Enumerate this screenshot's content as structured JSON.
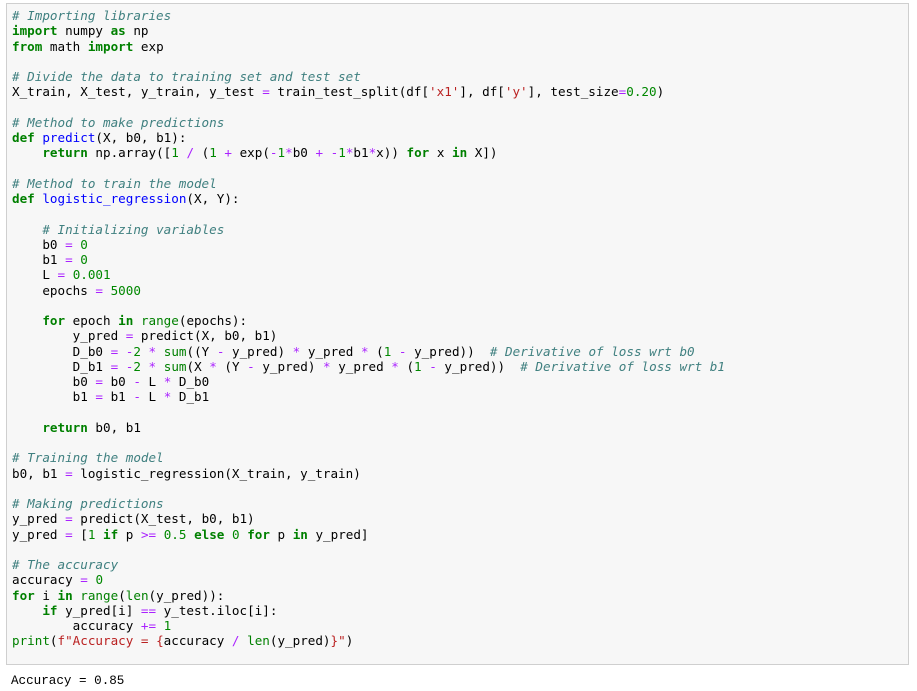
{
  "cell": {
    "lines": [
      [
        [
          "cm",
          "# Importing libraries"
        ]
      ],
      [
        [
          "kw",
          "import"
        ],
        [
          "tx",
          " numpy "
        ],
        [
          "kw",
          "as"
        ],
        [
          "tx",
          " np"
        ]
      ],
      [
        [
          "kw",
          "from"
        ],
        [
          "tx",
          " math "
        ],
        [
          "kw",
          "import"
        ],
        [
          "tx",
          " exp"
        ]
      ],
      [],
      [
        [
          "cm",
          "# Divide the data to training set and test set"
        ]
      ],
      [
        [
          "tx",
          "X_train, X_test, y_train, y_test "
        ],
        [
          "op",
          "="
        ],
        [
          "tx",
          " train_test_split(df["
        ],
        [
          "st",
          "'x1'"
        ],
        [
          "tx",
          "], df["
        ],
        [
          "st",
          "'y'"
        ],
        [
          "tx",
          "], test_size"
        ],
        [
          "op",
          "="
        ],
        [
          "nm",
          "0.20"
        ],
        [
          "tx",
          ")"
        ]
      ],
      [],
      [
        [
          "cm",
          "# Method to make predictions"
        ]
      ],
      [
        [
          "kw",
          "def"
        ],
        [
          "tx",
          " "
        ],
        [
          "fn",
          "predict"
        ],
        [
          "tx",
          "(X, b0, b1):"
        ]
      ],
      [
        [
          "tx",
          "    "
        ],
        [
          "kw",
          "return"
        ],
        [
          "tx",
          " np.array(["
        ],
        [
          "nm",
          "1"
        ],
        [
          "tx",
          " "
        ],
        [
          "op",
          "/"
        ],
        [
          "tx",
          " ("
        ],
        [
          "nm",
          "1"
        ],
        [
          "tx",
          " "
        ],
        [
          "op",
          "+"
        ],
        [
          "tx",
          " exp("
        ],
        [
          "op",
          "-"
        ],
        [
          "nm",
          "1"
        ],
        [
          "op",
          "*"
        ],
        [
          "tx",
          "b0 "
        ],
        [
          "op",
          "+"
        ],
        [
          "tx",
          " "
        ],
        [
          "op",
          "-"
        ],
        [
          "nm",
          "1"
        ],
        [
          "op",
          "*"
        ],
        [
          "tx",
          "b1"
        ],
        [
          "op",
          "*"
        ],
        [
          "tx",
          "x)) "
        ],
        [
          "kw",
          "for"
        ],
        [
          "tx",
          " x "
        ],
        [
          "kw",
          "in"
        ],
        [
          "tx",
          " X])"
        ]
      ],
      [],
      [
        [
          "cm",
          "# Method to train the model"
        ]
      ],
      [
        [
          "kw",
          "def"
        ],
        [
          "tx",
          " "
        ],
        [
          "fn",
          "logistic_regression"
        ],
        [
          "tx",
          "(X, Y):"
        ]
      ],
      [],
      [
        [
          "tx",
          "    "
        ],
        [
          "cm",
          "# Initializing variables"
        ]
      ],
      [
        [
          "tx",
          "    b0 "
        ],
        [
          "op",
          "="
        ],
        [
          "tx",
          " "
        ],
        [
          "nm",
          "0"
        ]
      ],
      [
        [
          "tx",
          "    b1 "
        ],
        [
          "op",
          "="
        ],
        [
          "tx",
          " "
        ],
        [
          "nm",
          "0"
        ]
      ],
      [
        [
          "tx",
          "    L "
        ],
        [
          "op",
          "="
        ],
        [
          "tx",
          " "
        ],
        [
          "nm",
          "0.001"
        ]
      ],
      [
        [
          "tx",
          "    epochs "
        ],
        [
          "op",
          "="
        ],
        [
          "tx",
          " "
        ],
        [
          "nm",
          "5000"
        ]
      ],
      [],
      [
        [
          "tx",
          "    "
        ],
        [
          "kw",
          "for"
        ],
        [
          "tx",
          " epoch "
        ],
        [
          "kw",
          "in"
        ],
        [
          "tx",
          " "
        ],
        [
          "bi",
          "range"
        ],
        [
          "tx",
          "(epochs):"
        ]
      ],
      [
        [
          "tx",
          "        y_pred "
        ],
        [
          "op",
          "="
        ],
        [
          "tx",
          " predict(X, b0, b1)"
        ]
      ],
      [
        [
          "tx",
          "        D_b0 "
        ],
        [
          "op",
          "="
        ],
        [
          "tx",
          " "
        ],
        [
          "op",
          "-"
        ],
        [
          "nm",
          "2"
        ],
        [
          "tx",
          " "
        ],
        [
          "op",
          "*"
        ],
        [
          "tx",
          " "
        ],
        [
          "bi",
          "sum"
        ],
        [
          "tx",
          "((Y "
        ],
        [
          "op",
          "-"
        ],
        [
          "tx",
          " y_pred) "
        ],
        [
          "op",
          "*"
        ],
        [
          "tx",
          " y_pred "
        ],
        [
          "op",
          "*"
        ],
        [
          "tx",
          " ("
        ],
        [
          "nm",
          "1"
        ],
        [
          "tx",
          " "
        ],
        [
          "op",
          "-"
        ],
        [
          "tx",
          " y_pred))  "
        ],
        [
          "cm",
          "# Derivative of loss wrt b0"
        ]
      ],
      [
        [
          "tx",
          "        D_b1 "
        ],
        [
          "op",
          "="
        ],
        [
          "tx",
          " "
        ],
        [
          "op",
          "-"
        ],
        [
          "nm",
          "2"
        ],
        [
          "tx",
          " "
        ],
        [
          "op",
          "*"
        ],
        [
          "tx",
          " "
        ],
        [
          "bi",
          "sum"
        ],
        [
          "tx",
          "(X "
        ],
        [
          "op",
          "*"
        ],
        [
          "tx",
          " (Y "
        ],
        [
          "op",
          "-"
        ],
        [
          "tx",
          " y_pred) "
        ],
        [
          "op",
          "*"
        ],
        [
          "tx",
          " y_pred "
        ],
        [
          "op",
          "*"
        ],
        [
          "tx",
          " ("
        ],
        [
          "nm",
          "1"
        ],
        [
          "tx",
          " "
        ],
        [
          "op",
          "-"
        ],
        [
          "tx",
          " y_pred))  "
        ],
        [
          "cm",
          "# Derivative of loss wrt b1"
        ]
      ],
      [
        [
          "tx",
          "        b0 "
        ],
        [
          "op",
          "="
        ],
        [
          "tx",
          " b0 "
        ],
        [
          "op",
          "-"
        ],
        [
          "tx",
          " L "
        ],
        [
          "op",
          "*"
        ],
        [
          "tx",
          " D_b0"
        ]
      ],
      [
        [
          "tx",
          "        b1 "
        ],
        [
          "op",
          "="
        ],
        [
          "tx",
          " b1 "
        ],
        [
          "op",
          "-"
        ],
        [
          "tx",
          " L "
        ],
        [
          "op",
          "*"
        ],
        [
          "tx",
          " D_b1"
        ]
      ],
      [],
      [
        [
          "tx",
          "    "
        ],
        [
          "kw",
          "return"
        ],
        [
          "tx",
          " b0, b1"
        ]
      ],
      [],
      [
        [
          "cm",
          "# Training the model"
        ]
      ],
      [
        [
          "tx",
          "b0, b1 "
        ],
        [
          "op",
          "="
        ],
        [
          "tx",
          " logistic_regression(X_train, y_train)"
        ]
      ],
      [],
      [
        [
          "cm",
          "# Making predictions"
        ]
      ],
      [
        [
          "tx",
          "y_pred "
        ],
        [
          "op",
          "="
        ],
        [
          "tx",
          " predict(X_test, b0, b1)"
        ]
      ],
      [
        [
          "tx",
          "y_pred "
        ],
        [
          "op",
          "="
        ],
        [
          "tx",
          " ["
        ],
        [
          "nm",
          "1"
        ],
        [
          "tx",
          " "
        ],
        [
          "kw",
          "if"
        ],
        [
          "tx",
          " p "
        ],
        [
          "op",
          ">="
        ],
        [
          "tx",
          " "
        ],
        [
          "nm",
          "0.5"
        ],
        [
          "tx",
          " "
        ],
        [
          "kw",
          "else"
        ],
        [
          "tx",
          " "
        ],
        [
          "nm",
          "0"
        ],
        [
          "tx",
          " "
        ],
        [
          "kw",
          "for"
        ],
        [
          "tx",
          " p "
        ],
        [
          "kw",
          "in"
        ],
        [
          "tx",
          " y_pred]"
        ]
      ],
      [],
      [
        [
          "cm",
          "# The accuracy"
        ]
      ],
      [
        [
          "tx",
          "accuracy "
        ],
        [
          "op",
          "="
        ],
        [
          "tx",
          " "
        ],
        [
          "nm",
          "0"
        ]
      ],
      [
        [
          "kw",
          "for"
        ],
        [
          "tx",
          " i "
        ],
        [
          "kw",
          "in"
        ],
        [
          "tx",
          " "
        ],
        [
          "bi",
          "range"
        ],
        [
          "tx",
          "("
        ],
        [
          "bi",
          "len"
        ],
        [
          "tx",
          "(y_pred)):"
        ]
      ],
      [
        [
          "tx",
          "    "
        ],
        [
          "kw",
          "if"
        ],
        [
          "tx",
          " y_pred[i] "
        ],
        [
          "op",
          "=="
        ],
        [
          "tx",
          " y_test.iloc[i]:"
        ]
      ],
      [
        [
          "tx",
          "        accuracy "
        ],
        [
          "op",
          "+="
        ],
        [
          "tx",
          " "
        ],
        [
          "nm",
          "1"
        ]
      ],
      [
        [
          "bi",
          "print"
        ],
        [
          "tx",
          "("
        ],
        [
          "st",
          "f\"Accuracy = {"
        ],
        [
          "tx",
          "accuracy "
        ],
        [
          "op",
          "/"
        ],
        [
          "tx",
          " "
        ],
        [
          "bi",
          "len"
        ],
        [
          "tx",
          "(y_pred)"
        ],
        [
          "st",
          "}\""
        ],
        [
          "tx",
          ")"
        ]
      ]
    ]
  },
  "output": {
    "text": "Accuracy = 0.85"
  }
}
